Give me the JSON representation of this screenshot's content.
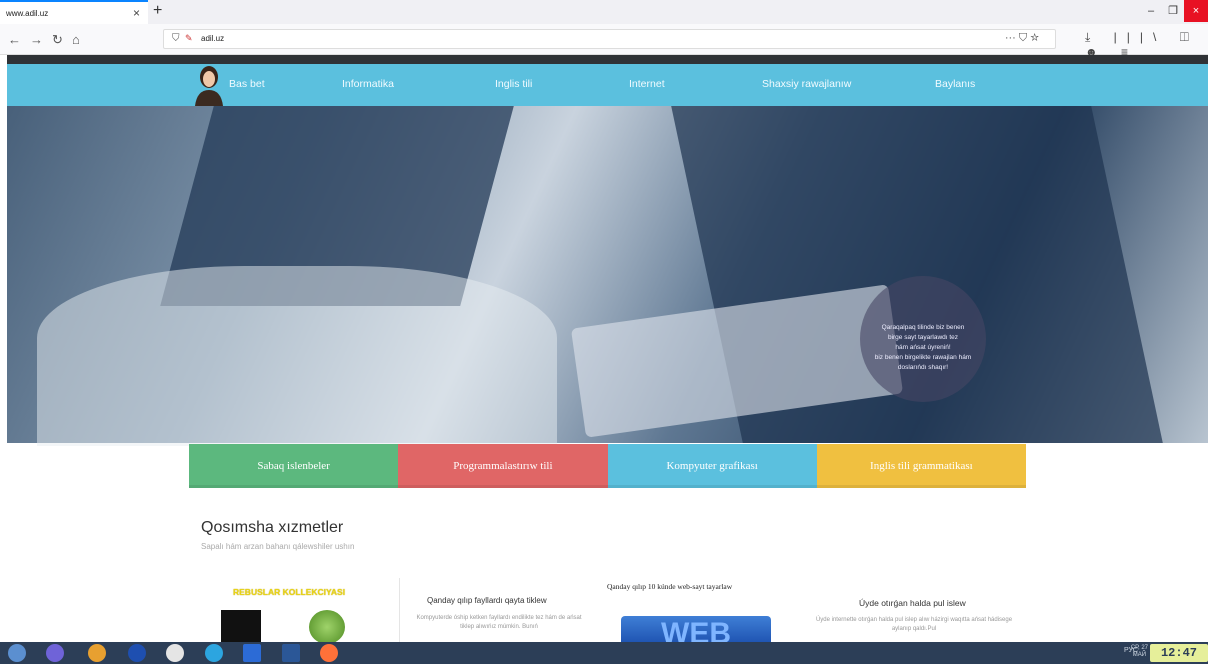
{
  "browser": {
    "tab_title": "www.adil.uz",
    "tab_close": "×",
    "new_tab": "+",
    "url": "adil.uz",
    "url_actions": "··· ⛉ ☆",
    "window_controls": [
      "–",
      "❐",
      "×"
    ],
    "toolbar_icons": [
      "⤓",
      "|||\\",
      "◫",
      "☻",
      "≡"
    ]
  },
  "nav": {
    "items": [
      "Bas bet",
      "Informatika",
      "Inglis tili",
      "Internet",
      "Shaxsiy rawajlanıw",
      "Baylanıs"
    ]
  },
  "hero": {
    "circle_text": [
      "Qaraqalpaq tilinde biz benen",
      "birge sayt tayarlawdı tez",
      "hám ańsat úyreniń!",
      "biz benen birgelikte rawajlan hám",
      "doslarıńdı shaqır!"
    ]
  },
  "tiles": [
    {
      "label": "Sabaq islenbeler",
      "color": "#5cb87e"
    },
    {
      "label": "Programmalastırıw tili",
      "color": "#e06666"
    },
    {
      "label": "Kompyuter grafikası",
      "color": "#5bc0de"
    },
    {
      "label": "Inglis tili grammatikası",
      "color": "#f0c040"
    }
  ],
  "services": {
    "title": "Qosımsha xızmetler",
    "subtitle": "Sapalı hám arzan bahanı qálewshiler ushın",
    "cards": [
      {
        "title": "REBUSLAR KOLLEKCIYASI"
      },
      {
        "title": "Qanday qılıp fayllardı qayta tiklew",
        "text": "Kompyuterde óship ketken fayllardı endilikte tez hám de ańsat tiklep alıwıńız múmkin. Bunıń"
      },
      {
        "title": "Qanday qılıp 10 kúnde web-sayt tayarlaw",
        "image_text": "WEB"
      },
      {
        "title": "Úyde otırǵan halda pul islew",
        "text": "Úyde internette otırǵan halda pul islep alıw házirgi waqıtta ańsat hádisege aylanıp qaldı.Pul"
      }
    ]
  },
  "taskbar": {
    "lang": "РУС",
    "date": [
      "СР, 27",
      "МАЙ"
    ],
    "time": "12:47"
  }
}
